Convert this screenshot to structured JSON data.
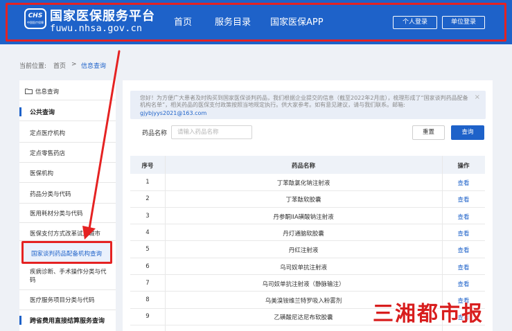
{
  "header": {
    "logo_badge": "CHS",
    "logo_badge_sub": "中国医疗保障",
    "site_name": "国家医保服务平台",
    "site_domain": "fuwu.nhsa.gov.cn",
    "nav": [
      "首页",
      "服务目录",
      "国家医保APP"
    ],
    "personal_login": "个人登录",
    "org_login": "单位登录",
    "brand_color": "#1e62c9",
    "highlight_color": "#e52222"
  },
  "breadcrumb": {
    "label": "当前位置:",
    "home": "首页",
    "separator": ">",
    "current": "信息查询"
  },
  "sidebar": {
    "root": "信息查询",
    "section_public": "公共查询",
    "items": [
      "定点医疗机构",
      "定点零售药店",
      "医保机构",
      "药品分类与代码",
      "医用耗材分类与代码",
      "医保支付方式改革试点城市",
      "国家谈判药品配备机构查询",
      "疾病诊断、手术操作分类与代码",
      "医疗服务项目分类与代码"
    ],
    "section_cross": "跨省费用直接结算服务查询"
  },
  "notice": {
    "text": "您好！为方便广大患者及时购买到国家医保谈判药品，我们根据企业提交的信息（截至2022年2月底），梳理形成了“国家谈判药品配备机构名单”，相关药品的医保支付政策按照当地规定执行。供大家参考。如有意见建议，请与我们联系。邮箱:",
    "email": "gjybjyys2021@163.com",
    "close": "×"
  },
  "search": {
    "label": "药品名称",
    "placeholder": "请输入药品名称",
    "reset": "重置",
    "query": "查询"
  },
  "table": {
    "headers": [
      "序号",
      "药品名称",
      "操作"
    ],
    "action_label": "查看",
    "rows": [
      [
        "1",
        "丁苯酞氯化钠注射液"
      ],
      [
        "2",
        "丁苯酞软胶囊"
      ],
      [
        "3",
        "丹参酮IIA磺酸钠注射液"
      ],
      [
        "4",
        "丹灯通脑软胶囊"
      ],
      [
        "5",
        "丹红注射液"
      ],
      [
        "6",
        "乌司奴单抗注射液"
      ],
      [
        "7",
        "乌司奴单抗注射液（静脉输注）"
      ],
      [
        "8",
        "乌美溴铵维兰特罗吸入粉雾剂"
      ],
      [
        "9",
        "乙磺酸尼达尼布软胶囊"
      ]
    ]
  },
  "watermark": "三湘都市报"
}
